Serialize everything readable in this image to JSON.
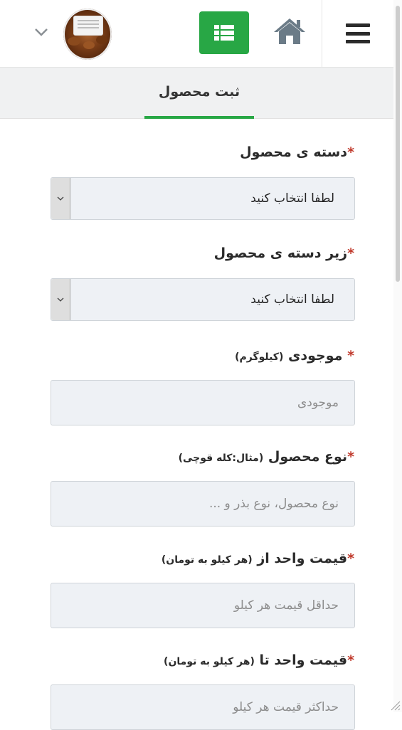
{
  "header": {
    "menu_icon": "hamburger-menu-icon",
    "home_icon": "home-icon",
    "list_icon": "list-icon",
    "list_button_color": "#28a745",
    "avatar_icon": "product-avatar",
    "dropdown_icon": "chevron-down-icon"
  },
  "tabs": {
    "active_label": "ثبت محصول",
    "accent_color": "#28a745"
  },
  "form": {
    "category": {
      "required_mark": "*",
      "label": "دسته ی محصول",
      "selected": "لطفا انتخاب کنید"
    },
    "subcategory": {
      "required_mark": "*",
      "label": "زیر دسته ی محصول",
      "selected": "لطفا انتخاب کنید"
    },
    "stock": {
      "required_mark": "*",
      "label": "موجودی",
      "hint": "(کیلوگرم)",
      "value": "",
      "placeholder": "موجودی"
    },
    "product_type": {
      "required_mark": "*",
      "label": "نوع محصول",
      "hint": "(مثال:کله قوچی)",
      "value": "",
      "placeholder": "نوع محصول، نوع بذر و ..."
    },
    "price_from": {
      "required_mark": "*",
      "label": "قیمت واحد از",
      "hint": "(هر کیلو به تومان)",
      "value": "",
      "placeholder": "حداقل قیمت هر کیلو"
    },
    "price_to": {
      "required_mark": "*",
      "label": "قیمت واحد تا",
      "hint": "(هر کیلو به تومان)",
      "value": "",
      "placeholder": "حداکثر قیمت هر کیلو"
    }
  }
}
